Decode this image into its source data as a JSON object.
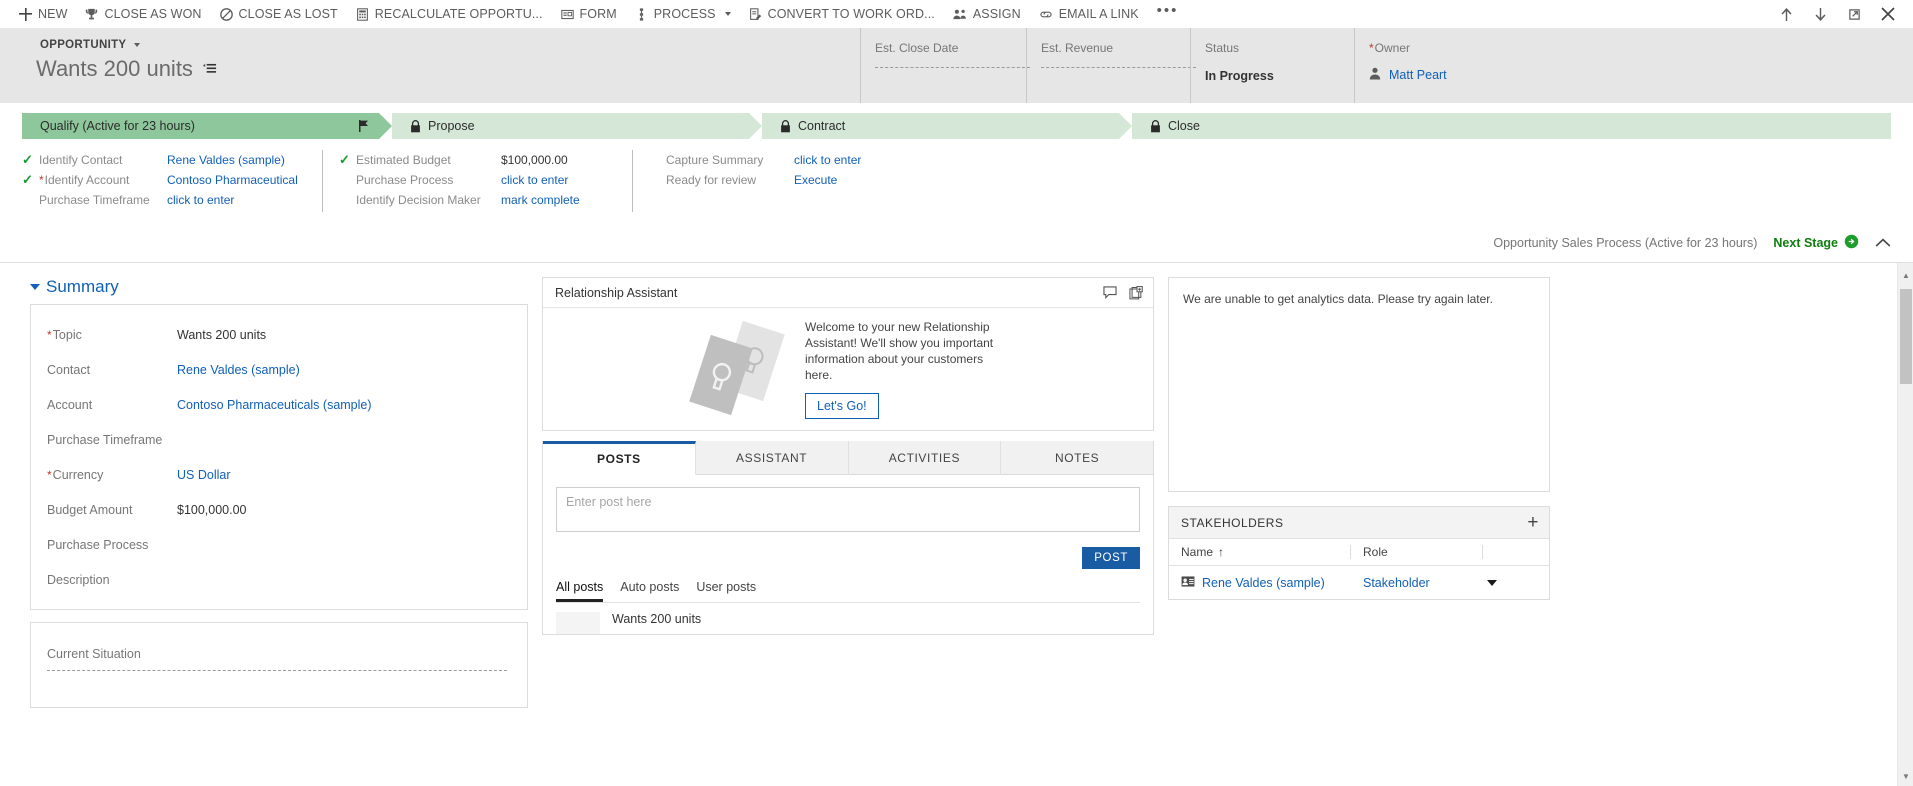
{
  "commandbar": {
    "items": [
      {
        "label": "NEW",
        "icon": "plus-icon"
      },
      {
        "label": "CLOSE AS WON",
        "icon": "trophy-icon"
      },
      {
        "label": "CLOSE AS LOST",
        "icon": "prohibited-icon"
      },
      {
        "label": "RECALCULATE OPPORTU...",
        "icon": "calculator-icon"
      },
      {
        "label": "FORM",
        "icon": "form-icon"
      },
      {
        "label": "PROCESS",
        "icon": "process-icon",
        "has_caret": true
      },
      {
        "label": "CONVERT TO WORK ORD...",
        "icon": "convert-icon"
      },
      {
        "label": "ASSIGN",
        "icon": "assign-icon"
      },
      {
        "label": "EMAIL A LINK",
        "icon": "link-icon"
      }
    ],
    "overflow_label": "•••",
    "window_buttons": [
      {
        "name": "up-arrow-icon"
      },
      {
        "name": "down-arrow-icon"
      },
      {
        "name": "popout-icon"
      },
      {
        "name": "close-icon"
      }
    ]
  },
  "header": {
    "entity_label": "OPPORTUNITY",
    "record_title": "Wants 200 units",
    "fields": [
      {
        "label": "Est. Close Date",
        "value": "",
        "required": false,
        "empty": true
      },
      {
        "label": "Est. Revenue",
        "value": "",
        "required": false,
        "empty": true
      },
      {
        "label": "Status",
        "value": "In Progress",
        "required": false,
        "empty": false
      },
      {
        "label": "Owner",
        "value": "Matt Peart",
        "required": true,
        "empty": false,
        "is_link": true
      }
    ]
  },
  "process": {
    "stages": [
      {
        "label": "Qualify (Active for 23 hours)",
        "state": "active",
        "icon": "flag-icon"
      },
      {
        "label": "Propose",
        "state": "locked",
        "icon": "lock-icon"
      },
      {
        "label": "Contract",
        "state": "locked",
        "icon": "lock-icon"
      },
      {
        "label": "Close",
        "state": "locked",
        "icon": "lock-icon"
      }
    ],
    "step_columns": [
      {
        "steps": [
          {
            "check": true,
            "required": false,
            "label": "Identify Contact",
            "value": "Rene Valdes (sample)"
          },
          {
            "check": true,
            "required": true,
            "label": "Identify Account",
            "value": "Contoso Pharmaceutical"
          },
          {
            "check": false,
            "required": false,
            "label": "Purchase Timeframe",
            "value": "click to enter"
          }
        ]
      },
      {
        "steps": [
          {
            "check": true,
            "required": false,
            "label": "Estimated Budget",
            "value": "$100,000.00"
          },
          {
            "check": false,
            "required": false,
            "label": "Purchase Process",
            "value": "click to enter"
          },
          {
            "check": false,
            "required": false,
            "label": "Identify Decision Maker",
            "value": "mark complete"
          }
        ]
      },
      {
        "steps": [
          {
            "check": false,
            "required": false,
            "label": "Capture Summary",
            "value": "click to enter"
          },
          {
            "check": false,
            "required": false,
            "label": "Ready for review",
            "value": "Execute",
            "highlighted": true
          }
        ]
      }
    ],
    "footer_name": "Opportunity Sales Process (Active for 23 hours)",
    "next_stage_label": "Next Stage",
    "collapse_icon": "chevron-up-icon",
    "highlight_color": "#e60000"
  },
  "summary": {
    "section_title": "Summary",
    "fields": [
      {
        "label": "Topic",
        "value": "Wants 200 units",
        "required": true,
        "type": "text"
      },
      {
        "label": "Contact",
        "value": "Rene Valdes (sample)",
        "required": false,
        "type": "link"
      },
      {
        "label": "Account",
        "value": "Contoso Pharmaceuticals (sample)",
        "required": false,
        "type": "link"
      },
      {
        "label": "Purchase Timeframe",
        "value": "",
        "required": false,
        "type": "empty"
      },
      {
        "label": "Currency",
        "value": "US Dollar",
        "required": true,
        "type": "link"
      },
      {
        "label": "Budget Amount",
        "value": "$100,000.00",
        "required": false,
        "type": "text"
      },
      {
        "label": "Purchase Process",
        "value": "",
        "required": false,
        "type": "empty"
      },
      {
        "label": "Description",
        "value": "",
        "required": false,
        "type": "empty"
      }
    ],
    "current_situation_label": "Current Situation"
  },
  "assistant": {
    "panel_title": "Relationship Assistant",
    "welcome_text": "Welcome to your new Relationship Assistant! We'll show you important information about your customers here.",
    "cta_label": "Let's Go!",
    "header_icons": [
      {
        "name": "comment-icon"
      },
      {
        "name": "cards-icon"
      }
    ]
  },
  "social": {
    "tabs": [
      {
        "label": "POSTS",
        "active": true
      },
      {
        "label": "ASSISTANT",
        "active": false
      },
      {
        "label": "ACTIVITIES",
        "active": false
      },
      {
        "label": "NOTES",
        "active": false
      }
    ],
    "post_placeholder": "Enter post here",
    "post_value": "",
    "post_button_label": "POST",
    "filters": [
      {
        "label": "All posts",
        "active": true
      },
      {
        "label": "Auto posts",
        "active": false
      },
      {
        "label": "User posts",
        "active": false
      }
    ],
    "posts": [
      {
        "title": "Wants 200 units"
      }
    ]
  },
  "analytics": {
    "message": "We are unable to get analytics data. Please try again later."
  },
  "stakeholders": {
    "panel_title": "STAKEHOLDERS",
    "add_label": "+",
    "columns": [
      {
        "label": "Name",
        "sort": "↑"
      },
      {
        "label": "Role",
        "sort": ""
      },
      {
        "label": "",
        "sort": ""
      }
    ],
    "rows": [
      {
        "name": "Rene Valdes (sample)",
        "role": "Stakeholder",
        "icon": "contact-card-icon"
      }
    ]
  },
  "colors": {
    "accent_blue": "#1160b7",
    "stage_active": "#8fc79c",
    "stage_locked": "#d5e8d8",
    "next_stage_green": "#107c10",
    "post_button": "#1a5ca3"
  }
}
